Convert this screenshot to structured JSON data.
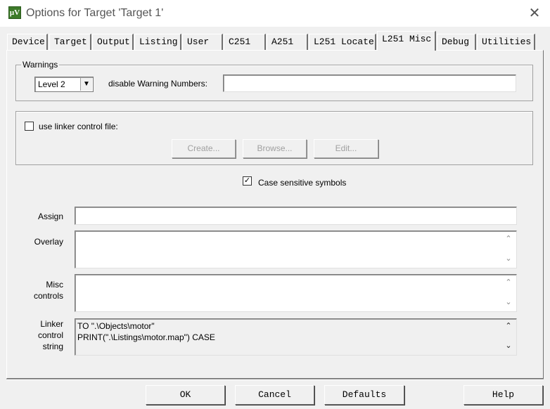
{
  "window": {
    "title": "Options for Target 'Target 1'",
    "icon": "keil-uvision-icon",
    "close_glyph": "✕"
  },
  "tabs": [
    {
      "label": "Device",
      "active": false
    },
    {
      "label": "Target",
      "active": false
    },
    {
      "label": "Output",
      "active": false
    },
    {
      "label": "Listing",
      "active": false
    },
    {
      "label": "User",
      "active": false
    },
    {
      "label": "C251",
      "active": false
    },
    {
      "label": "A251",
      "active": false
    },
    {
      "label": "L251 Locate",
      "active": false
    },
    {
      "label": "L251 Misc",
      "active": true
    },
    {
      "label": "Debug",
      "active": false
    },
    {
      "label": "Utilities",
      "active": false
    }
  ],
  "warnings": {
    "group_label": "Warnings",
    "level_value": "Level 2",
    "disable_label": "disable Warning Numbers:",
    "disable_value": ""
  },
  "linker_file": {
    "checkbox_label": "use linker control file:",
    "checked": false,
    "create_label": "Create...",
    "browse_label": "Browse...",
    "edit_label": "Edit..."
  },
  "case_sensitive": {
    "label": "Case sensitive symbols",
    "checked": true
  },
  "fields": {
    "assign_label": "Assign",
    "assign_value": "",
    "overlay_label": "Overlay",
    "overlay_value": "",
    "misc_label_line1": "Misc",
    "misc_label_line2": "controls",
    "misc_value": "",
    "linker_label_line1": "Linker",
    "linker_label_line2": "control",
    "linker_label_line3": "string",
    "linker_value": "TO \".\\Objects\\motor\"\nPRINT(\".\\Listings\\motor.map\") CASE"
  },
  "buttons": {
    "ok": "OK",
    "cancel": "Cancel",
    "defaults": "Defaults",
    "help": "Help"
  },
  "glyphs": {
    "dropdown": "▼",
    "check": "✓",
    "up": "⌃",
    "down": "⌄"
  }
}
